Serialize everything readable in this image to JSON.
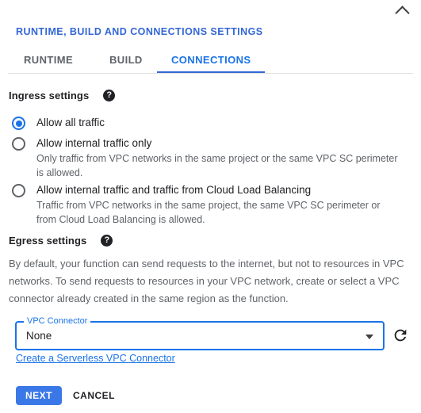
{
  "panel": {
    "title": "RUNTIME, BUILD AND CONNECTIONS SETTINGS",
    "collapse_icon": "chevron-up-icon"
  },
  "tabs": [
    {
      "label": "RUNTIME",
      "active": false
    },
    {
      "label": "BUILD",
      "active": false
    },
    {
      "label": "CONNECTIONS",
      "active": true
    }
  ],
  "ingress": {
    "heading": "Ingress settings",
    "help_icon": "help-icon",
    "options": [
      {
        "label": "Allow all traffic",
        "description": "",
        "selected": true
      },
      {
        "label": "Allow internal traffic only",
        "description": "Only traffic from VPC networks in the same project or the same VPC SC perimeter is allowed.",
        "selected": false
      },
      {
        "label": "Allow internal traffic and traffic from Cloud Load Balancing",
        "description": "Traffic from VPC networks in the same project, the same VPC SC perimeter or from Cloud Load Balancing is allowed.",
        "selected": false
      }
    ]
  },
  "egress": {
    "heading": "Egress settings",
    "help_icon": "help-icon",
    "note": "By default, your function can send requests to the internet, but not to resources in VPC networks. To send requests to resources in your VPC network, create or select a VPC connector already created in the same region as the function.",
    "connector_field": {
      "label": "VPC Connector",
      "value": "None",
      "dropdown_icon": "chevron-down-icon",
      "refresh_icon": "refresh-icon"
    },
    "create_link": "Create a Serverless VPC Connector"
  },
  "footer": {
    "next_label": "NEXT",
    "cancel_label": "CANCEL"
  },
  "colors": {
    "accent": "#1a73e8",
    "title": "#3367d6",
    "button": "#3b78e7",
    "text": "#202124",
    "muted": "#5f6368"
  }
}
